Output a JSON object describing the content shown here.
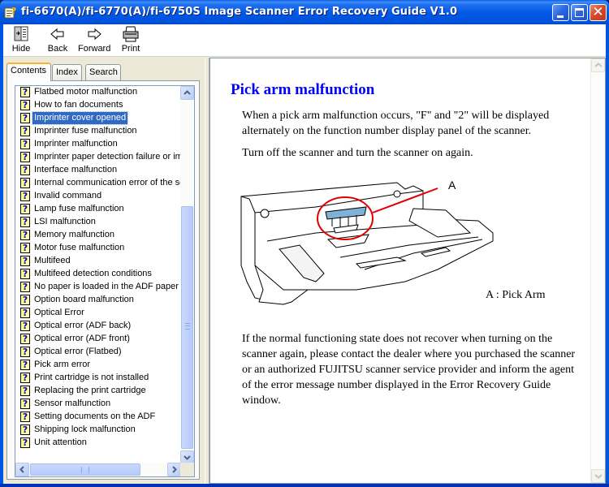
{
  "window": {
    "title": "fi-6670(A)/fi-6770(A)/fi-6750S Image Scanner Error Recovery Guide V1.0",
    "icon": "help-book-icon",
    "controls": [
      "minimize",
      "maximize",
      "close"
    ],
    "close_glyph": "✕"
  },
  "toolbar": {
    "hide_label": "Hide",
    "back_label": "Back",
    "forward_label": "Forward",
    "print_label": "Print"
  },
  "nav": {
    "tabs": [
      {
        "label": "Contents",
        "active": true
      },
      {
        "label": "Index",
        "active": false
      },
      {
        "label": "Search",
        "active": false
      }
    ],
    "topics": [
      {
        "label": "Flatbed motor malfunction"
      },
      {
        "label": "How to fan documents"
      },
      {
        "label": "Imprinter cover opened",
        "selected": true
      },
      {
        "label": "Imprinter fuse malfunction"
      },
      {
        "label": "Imprinter malfunction"
      },
      {
        "label": "Imprinter paper detection failure or impr"
      },
      {
        "label": "Interface malfunction"
      },
      {
        "label": "Internal communication error of the sca"
      },
      {
        "label": "Invalid command"
      },
      {
        "label": "Lamp fuse malfunction"
      },
      {
        "label": "LSI malfunction"
      },
      {
        "label": "Memory malfunction"
      },
      {
        "label": "Motor fuse malfunction"
      },
      {
        "label": "Multifeed"
      },
      {
        "label": "Multifeed detection conditions"
      },
      {
        "label": "No paper is loaded in the ADF paper ch"
      },
      {
        "label": "Option board malfunction"
      },
      {
        "label": "Optical Error"
      },
      {
        "label": "Optical error (ADF back)"
      },
      {
        "label": "Optical error (ADF front)"
      },
      {
        "label": "Optical error (Flatbed)"
      },
      {
        "label": "Pick arm error"
      },
      {
        "label": "Print cartridge is not installed"
      },
      {
        "label": "Replacing the print cartridge"
      },
      {
        "label": "Sensor malfunction"
      },
      {
        "label": "Setting documents on the ADF"
      },
      {
        "label": "Shipping lock malfunction"
      },
      {
        "label": "Unit attention"
      }
    ],
    "topic_icon": "?"
  },
  "content": {
    "title": "Pick arm malfunction",
    "paragraph1": "When a pick arm malfunction occurs, \"F\" and \"2\" will be displayed alternately on the function number display panel of the scanner.",
    "paragraph2": "Turn off the scanner and turn the scanner on again.",
    "figure_callout": "A",
    "figure_caption": "A : Pick Arm",
    "paragraph3": "If the normal functioning state does not recover when turning on the scanner again, please contact the dealer where you purchased the scanner or an authorized FUJITSU scanner service provider and inform the agent of the error message number displayed in the Error Recovery Guide window."
  },
  "colors": {
    "title_bar": "#0054e3",
    "topic_heading": "#0000ff",
    "selection": "#316ac5",
    "callout_red": "#e00000",
    "pick_arm_highlight": "#7fb2d6"
  }
}
